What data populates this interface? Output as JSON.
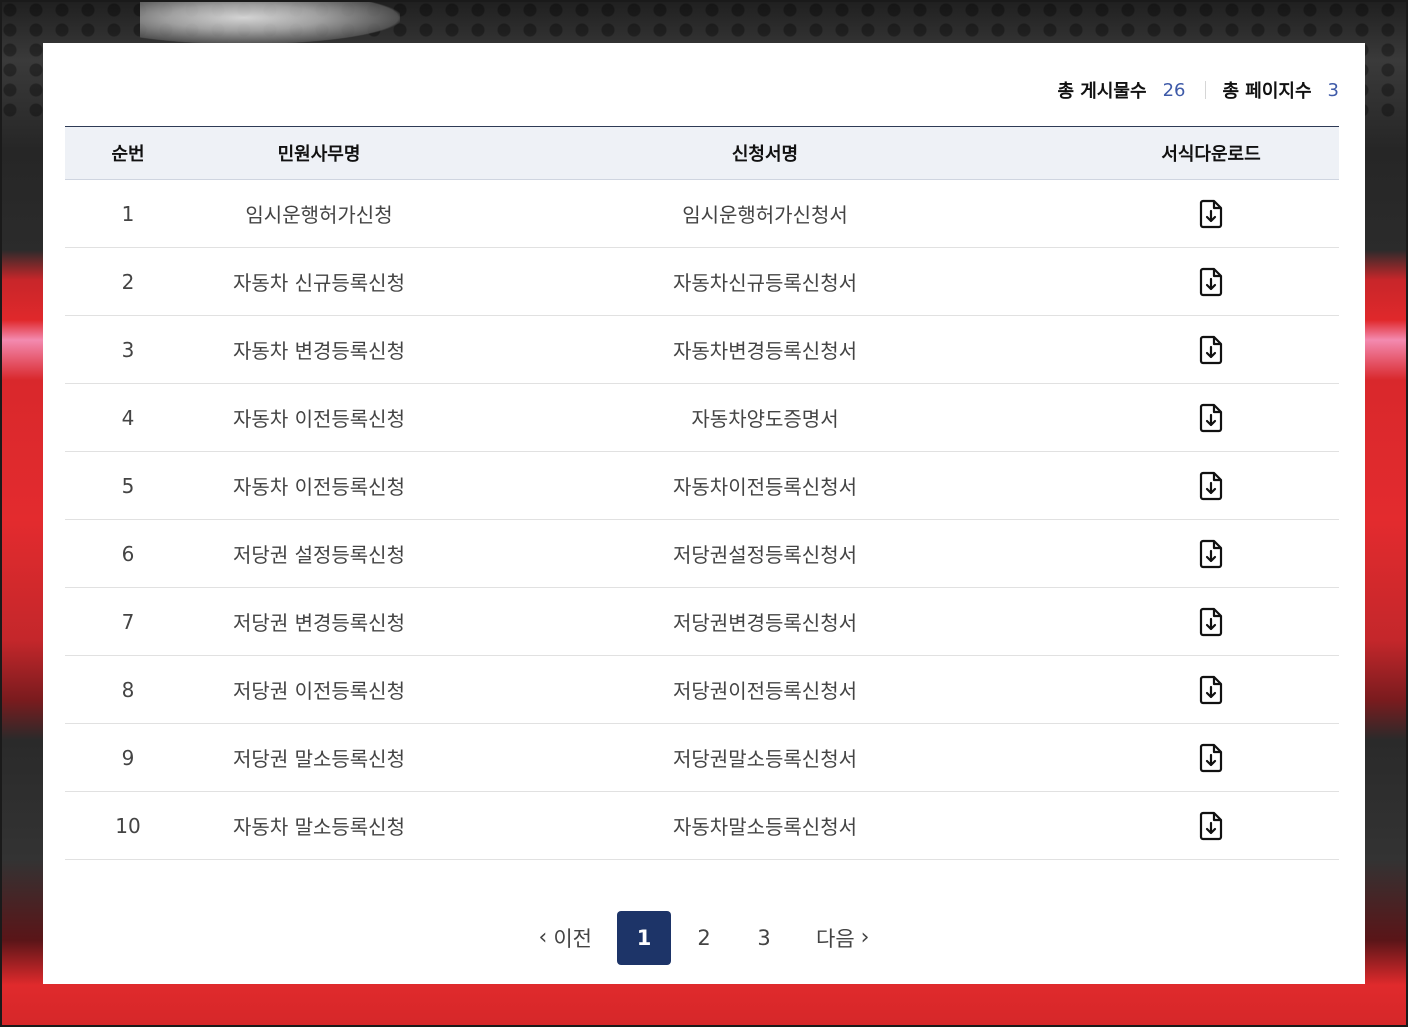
{
  "summary": {
    "total_posts_label": "총 게시물수",
    "total_posts_value": "26",
    "total_pages_label": "총 페이지수",
    "total_pages_value": "3"
  },
  "table": {
    "headers": {
      "no": "순번",
      "task": "민원사무명",
      "form": "신청서명",
      "download": "서식다운로드"
    },
    "rows": [
      {
        "no": "1",
        "task": "임시운행허가신청",
        "form": "임시운행허가신청서",
        "icon": "file-download-icon"
      },
      {
        "no": "2",
        "task": "자동차 신규등록신청",
        "form": "자동차신규등록신청서",
        "icon": "file-download-icon"
      },
      {
        "no": "3",
        "task": "자동차 변경등록신청",
        "form": "자동차변경등록신청서",
        "icon": "file-download-icon"
      },
      {
        "no": "4",
        "task": "자동차 이전등록신청",
        "form": "자동차양도증명서",
        "icon": "file-download-icon"
      },
      {
        "no": "5",
        "task": "자동차 이전등록신청",
        "form": "자동차이전등록신청서",
        "icon": "file-download-icon"
      },
      {
        "no": "6",
        "task": "저당권 설정등록신청",
        "form": "저당권설정등록신청서",
        "icon": "file-download-icon"
      },
      {
        "no": "7",
        "task": "저당권 변경등록신청",
        "form": "저당권변경등록신청서",
        "icon": "file-download-icon"
      },
      {
        "no": "8",
        "task": "저당권 이전등록신청",
        "form": "저당권이전등록신청서",
        "icon": "file-download-icon"
      },
      {
        "no": "9",
        "task": "저당권 말소등록신청",
        "form": "저당권말소등록신청서",
        "icon": "file-download-icon"
      },
      {
        "no": "10",
        "task": "자동차 말소등록신청",
        "form": "자동차말소등록신청서",
        "icon": "file-download-icon"
      }
    ]
  },
  "pagination": {
    "prev_label": "이전",
    "next_label": "다음",
    "pages": [
      "1",
      "2",
      "3"
    ],
    "current": "1"
  },
  "colors": {
    "accent": "#1d3468",
    "count_text": "#3e5aa8",
    "header_bg": "#eef1f6"
  }
}
